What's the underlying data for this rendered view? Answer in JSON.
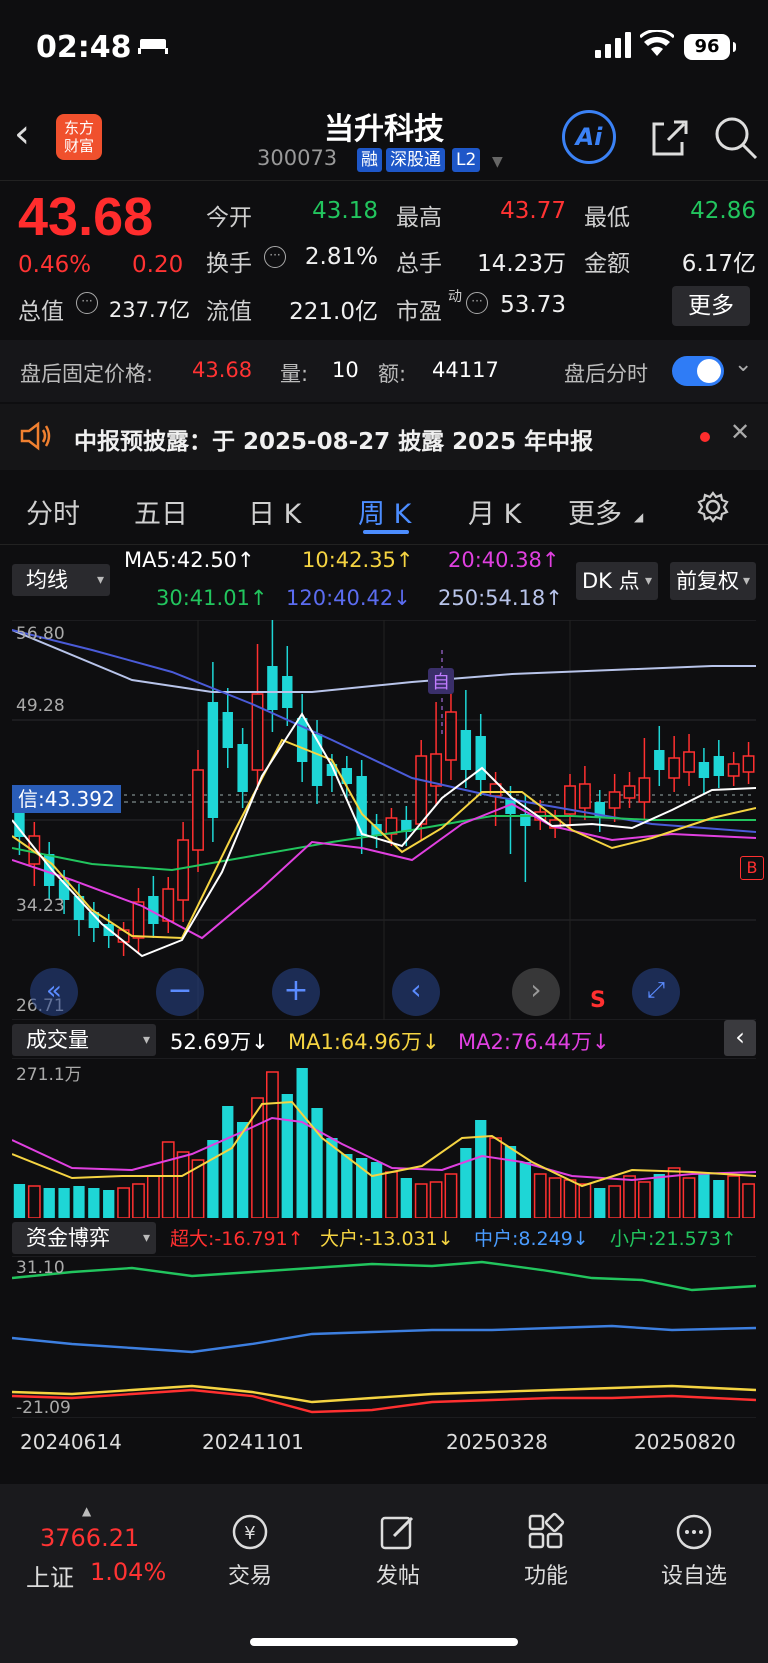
{
  "status": {
    "time": "02:48",
    "battery": "96"
  },
  "header": {
    "logo_text": "东方\n财富",
    "name": "当升科技",
    "code": "300073",
    "tags": [
      "融",
      "深股通",
      "L2"
    ],
    "ai_label": "Ai"
  },
  "quote": {
    "price": "43.68",
    "change_pct": "0.46%",
    "change": "0.20",
    "open_label": "今开",
    "open": "43.18",
    "high_label": "最高",
    "high": "43.77",
    "low_label": "最低",
    "low": "42.86",
    "turnover_label": "换手",
    "turnover": "2.81%",
    "volume_label": "总手",
    "volume": "14.23万",
    "amount_label": "金额",
    "amount": "6.17亿",
    "mktcap_label": "总值",
    "mktcap": "237.7亿",
    "float_label": "流值",
    "float": "221.0亿",
    "pe_label": "市盈",
    "pe_sup": "动",
    "pe": "53.73",
    "more": "更多"
  },
  "after_hours": {
    "label": "盘后固定价格:",
    "price": "43.68",
    "vol_label": "量:",
    "vol": "10",
    "amt_label": "额:",
    "amt": "44117",
    "toggle_label": "盘后分时"
  },
  "notice": {
    "text": "中报预披露：于 2025-08-27 披露 2025 年中报"
  },
  "tabs": [
    "分时",
    "五日",
    "日 K",
    "周 K",
    "月 K",
    "更多"
  ],
  "active_tab": "周 K",
  "kline": {
    "indicator": "均线",
    "ma5": "MA5:42.50↑",
    "ma10": "10:42.35↑",
    "ma20": "20:40.38↑",
    "ma30": "30:41.01↑",
    "ma120": "120:40.42↓",
    "ma250": "250:54.18↑",
    "dk_button": "DK 点",
    "adjust_button": "前复权",
    "y_max": "56.80",
    "y_mid": "49.28",
    "y_low": "34.23",
    "y_min": "26.71",
    "cursor_label": "信:43.392",
    "marker_zi": "自",
    "marker_s": "S",
    "marker_b": "B",
    "colors": {
      "ma5": "#ffffff",
      "ma10": "#f5d442",
      "ma20": "#e040e0",
      "ma30": "#22c55e",
      "ma120": "#4a5bd8",
      "ma250": "#b8c4ea",
      "up": "#ff3030",
      "down": "#1ed6d6"
    }
  },
  "volume": {
    "indicator": "成交量",
    "value": "52.69万↓",
    "ma1": "MA1:64.96万↓",
    "ma2": "MA2:76.44万↓",
    "y_max": "271.1万"
  },
  "capital": {
    "indicator": "资金博弈",
    "super": "超大:-16.791↑",
    "large": "大户:-13.031↓",
    "medium": "中户:8.249↓",
    "small": "小户:21.573↑",
    "y_max": "31.10",
    "y_min": "-21.09"
  },
  "dates": [
    "20240614",
    "20241101",
    "20250328",
    "20250820"
  ],
  "bottom_nav": {
    "index_value": "3766.21",
    "index_name": "上证",
    "index_pct": "1.04%",
    "items": [
      "交易",
      "发帖",
      "功能",
      "设自选"
    ]
  }
}
